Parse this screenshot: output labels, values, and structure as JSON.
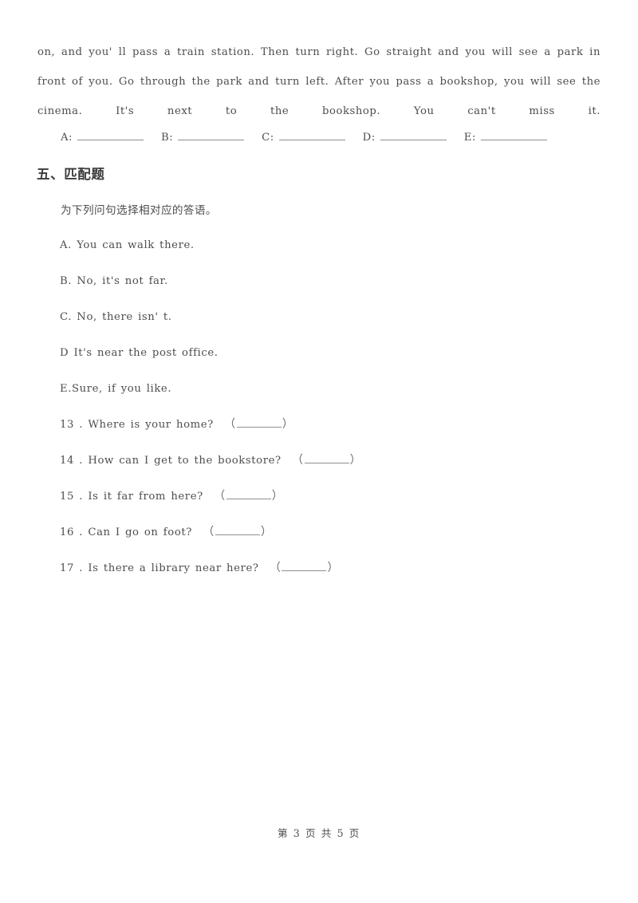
{
  "document": {
    "passage": "on, and you' ll pass a train station. Then turn right. Go straight and you will see a park in front of you. Go through the park and turn left. After you pass a bookshop, you will see the cinema. It's next to the bookshop. You can't miss it."
  },
  "answer_row": {
    "slots": [
      {
        "label": "A:"
      },
      {
        "label": "B:"
      },
      {
        "label": "C:"
      },
      {
        "label": "D:"
      },
      {
        "label": "E:"
      }
    ]
  },
  "section": {
    "heading": "五、匹配题",
    "instruction": "为下列问句选择相对应的答语。",
    "options": [
      {
        "text": "A. You can walk there."
      },
      {
        "text": "B. No, it's not far."
      },
      {
        "text": "C. No, there isn' t."
      },
      {
        "text": "D It's near the post office."
      },
      {
        "text": "E.Sure, if you like."
      }
    ],
    "questions": [
      {
        "number": "13 .",
        "text": "Where is your home?"
      },
      {
        "number": "14 .",
        "text": "How can I get to the bookstore?"
      },
      {
        "number": "15 .",
        "text": "Is it far from here?"
      },
      {
        "number": "16 .",
        "text": "Can I go on foot?"
      },
      {
        "number": "17 .",
        "text": "Is there a library near here?"
      }
    ],
    "paren_open": "（",
    "paren_close": "）"
  },
  "footer": {
    "text": "第 3 页 共 5 页"
  }
}
